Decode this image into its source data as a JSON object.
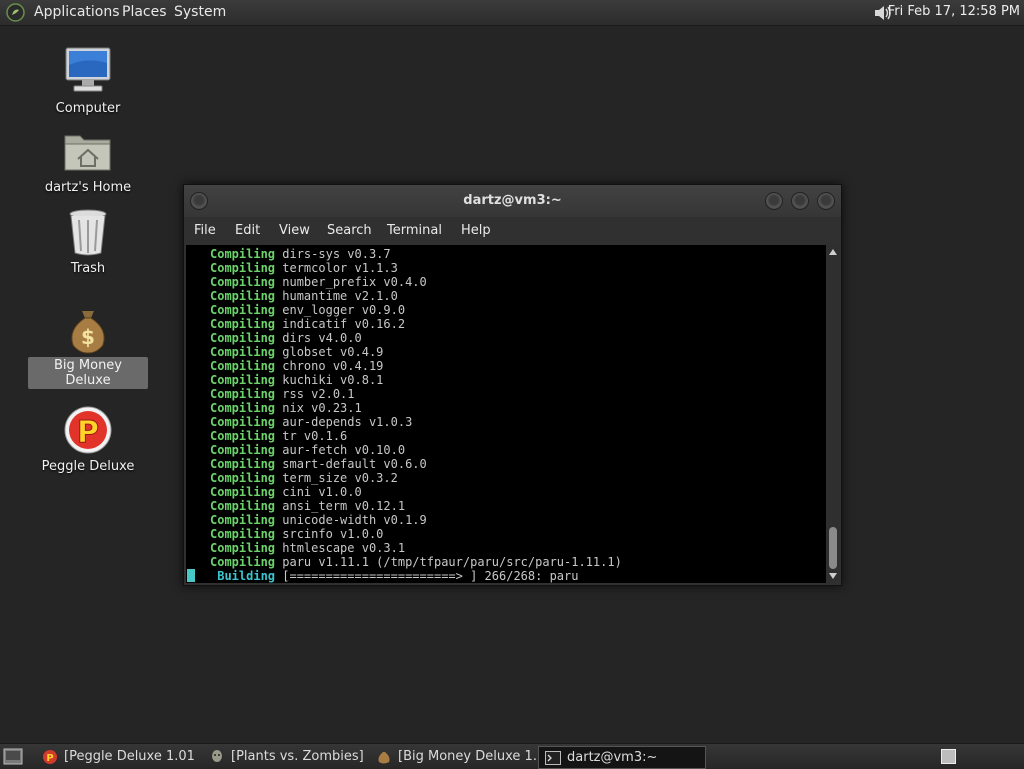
{
  "top_panel": {
    "menus": [
      "Applications",
      "Places",
      "System"
    ],
    "clock": "Fri Feb 17, 12:58 PM",
    "apps_icon": "gnome-foot-icon",
    "volume_icon": "volume-icon"
  },
  "desktop": {
    "icons": [
      {
        "label": "Computer",
        "icon": "computer-icon",
        "selected": false
      },
      {
        "label": "dartz's Home",
        "icon": "home-folder-icon",
        "selected": false
      },
      {
        "label": "Trash",
        "icon": "trash-icon",
        "selected": false
      },
      {
        "label": "Big Money Deluxe",
        "icon": "money-bag-icon",
        "selected": true
      },
      {
        "label": "Peggle Deluxe",
        "icon": "peggle-icon",
        "selected": false
      }
    ]
  },
  "terminal": {
    "title": "dartz@vm3:~",
    "menus": [
      "File",
      "Edit",
      "View",
      "Search",
      "Terminal",
      "Help"
    ],
    "lines": [
      {
        "kw": "Compiling",
        "text": " dirs-sys v0.3.7"
      },
      {
        "kw": "Compiling",
        "text": " termcolor v1.1.3"
      },
      {
        "kw": "Compiling",
        "text": " number_prefix v0.4.0"
      },
      {
        "kw": "Compiling",
        "text": " humantime v2.1.0"
      },
      {
        "kw": "Compiling",
        "text": " env_logger v0.9.0"
      },
      {
        "kw": "Compiling",
        "text": " indicatif v0.16.2"
      },
      {
        "kw": "Compiling",
        "text": " dirs v4.0.0"
      },
      {
        "kw": "Compiling",
        "text": " globset v0.4.9"
      },
      {
        "kw": "Compiling",
        "text": " chrono v0.4.19"
      },
      {
        "kw": "Compiling",
        "text": " kuchiki v0.8.1"
      },
      {
        "kw": "Compiling",
        "text": " rss v2.0.1"
      },
      {
        "kw": "Compiling",
        "text": " nix v0.23.1"
      },
      {
        "kw": "Compiling",
        "text": " aur-depends v1.0.3"
      },
      {
        "kw": "Compiling",
        "text": " tr v0.1.6"
      },
      {
        "kw": "Compiling",
        "text": " aur-fetch v0.10.0"
      },
      {
        "kw": "Compiling",
        "text": " smart-default v0.6.0"
      },
      {
        "kw": "Compiling",
        "text": " term_size v0.3.2"
      },
      {
        "kw": "Compiling",
        "text": " cini v1.0.0"
      },
      {
        "kw": "Compiling",
        "text": " ansi_term v0.12.1"
      },
      {
        "kw": "Compiling",
        "text": " unicode-width v0.1.9"
      },
      {
        "kw": "Compiling",
        "text": " srcinfo v1.0.0"
      },
      {
        "kw": "Compiling",
        "text": " htmlescape v0.3.1"
      },
      {
        "kw": "Compiling",
        "text": " paru v1.11.1 (/tmp/tfpaur/paru/src/paru-1.11.1)"
      },
      {
        "kw": " Building",
        "text": " [=======================> ] 266/268: paru",
        "build": true
      }
    ]
  },
  "taskbar": {
    "tasks": [
      {
        "label": "[Peggle Deluxe 1.01]",
        "icon": "peggle-small-icon",
        "active": false
      },
      {
        "label": "[Plants vs. Zombies]",
        "icon": "zombie-icon",
        "active": false
      },
      {
        "label": "[Big Money Deluxe 1…",
        "icon": "money-small-icon",
        "active": false
      },
      {
        "label": "dartz@vm3:~",
        "icon": "terminal-icon",
        "active": true
      }
    ],
    "show_desktop_icon": "show-desktop-icon",
    "workspace_icon": "workspace-switcher-icon"
  },
  "colors": {
    "keyword": "#6cd36c",
    "building": "#39c6cf",
    "cursor": "#48c8c8",
    "desktop": "#252525"
  }
}
